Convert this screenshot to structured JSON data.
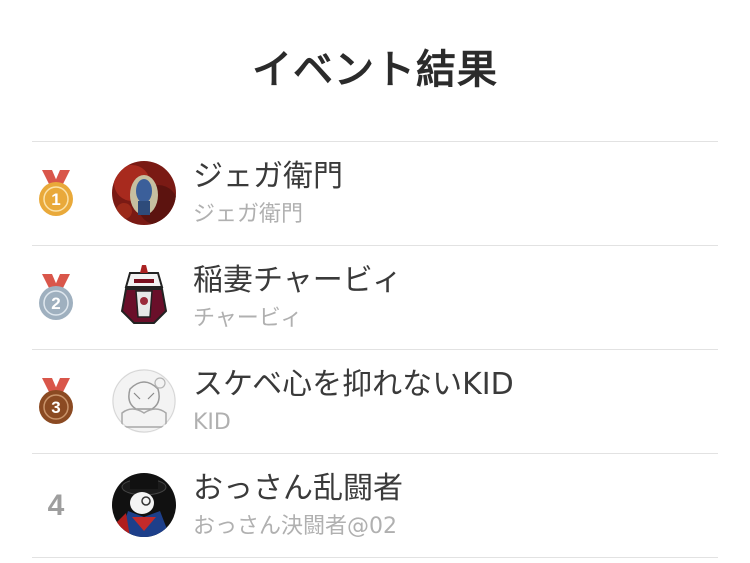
{
  "header": {
    "title": "イベント結果"
  },
  "colors": {
    "gold": "#e9a93a",
    "silver": "#9fb0bf",
    "bronze": "#8b4a22",
    "ribbon": "#d9564a",
    "divider": "#e2e2e2",
    "rank_text": "#9e9e9e"
  },
  "results": [
    {
      "rank": "1",
      "medal": "gold-medal-icon",
      "name": "ジェガ衛門",
      "sub_name": "ジェガ衛門"
    },
    {
      "rank": "2",
      "medal": "silver-medal-icon",
      "name": "稲妻チャービィ",
      "sub_name": "チャービィ"
    },
    {
      "rank": "3",
      "medal": "bronze-medal-icon",
      "name": "スケベ心を抑れないKID",
      "sub_name": "KID"
    },
    {
      "rank": "4",
      "medal": "",
      "name": "おっさん乱闘者",
      "sub_name": "おっさん決闘者@02"
    }
  ]
}
